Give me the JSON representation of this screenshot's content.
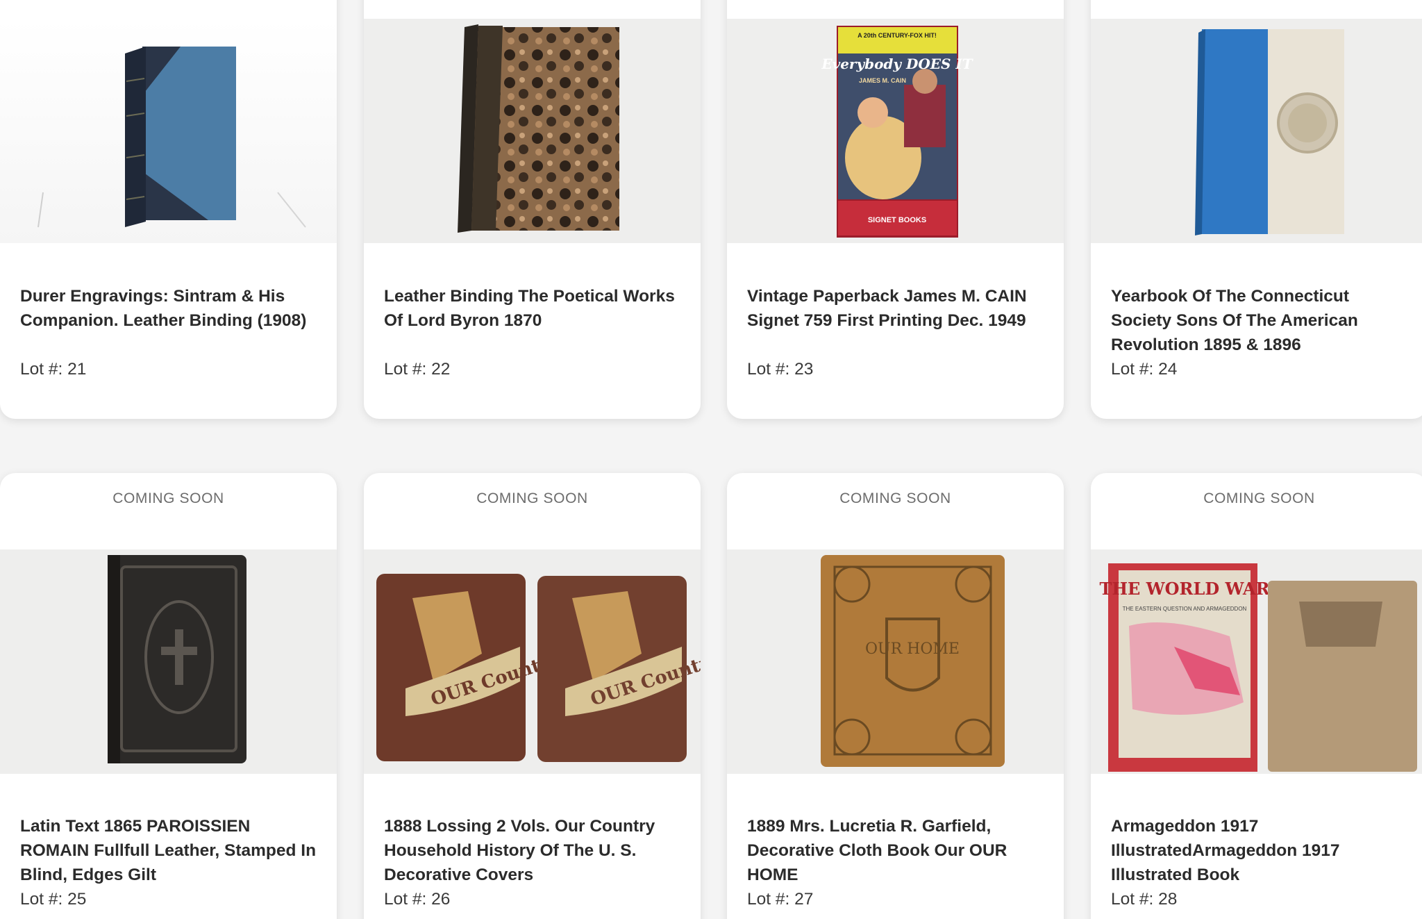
{
  "lots": [
    {
      "title": "Durer Engravings: Sintram & His Companion. Leather Binding (1908)",
      "lot": "Lot #: 21",
      "badge": "",
      "image": "blue-leather-book"
    },
    {
      "title": "Leather Binding The Poetical Works Of Lord Byron 1870",
      "lot": "Lot #: 22",
      "badge": "",
      "image": "marbled-book"
    },
    {
      "title": "Vintage Paperback James M. CAIN Signet 759 First Printing Dec. 1949",
      "lot": "Lot #: 23",
      "badge": "",
      "image": "pulp-paperback"
    },
    {
      "title": "Yearbook Of The Connecticut Society Sons Of The American Revolution 1895 & 1896",
      "lot": "Lot #: 24",
      "badge": "",
      "image": "blue-white-book"
    },
    {
      "title": "Latin Text 1865 PAROISSIEN ROMAIN Fullfull Leather, Stamped In Blind, Edges Gilt",
      "lot": "Lot #: 25",
      "badge": "COMING SOON",
      "image": "black-leather-book"
    },
    {
      "title": "1888 Lossing 2 Vols. Our Country Household History Of The U. S. Decorative Covers",
      "lot": "Lot #: 26",
      "badge": "COMING SOON",
      "image": "two-brown-books"
    },
    {
      "title": "1889 Mrs. Lucretia R. Garfield, Decorative Cloth Book Our OUR HOME",
      "lot": "Lot #: 27",
      "badge": "COMING SOON",
      "image": "tan-cloth-book"
    },
    {
      "title": "Armageddon 1917 IllustratedArmageddon 1917 Illustrated Book",
      "lot": "Lot #: 28",
      "badge": "COMING SOON",
      "image": "two-war-books"
    }
  ],
  "image_text": {
    "pulp_title": "Everybody DOES IT",
    "pulp_author": "JAMES M. CAIN",
    "pulp_tagline": "A 20th CENTURY-FOX HIT!",
    "pulp_publisher": "SIGNET BOOKS",
    "country_a": "OUR Country",
    "country_b": "OUR Country",
    "our_home": "OUR HOME",
    "world_war": "THE WORLD WAR",
    "world_war_sub": "THE EASTERN QUESTION AND ARMAGEDDON"
  }
}
